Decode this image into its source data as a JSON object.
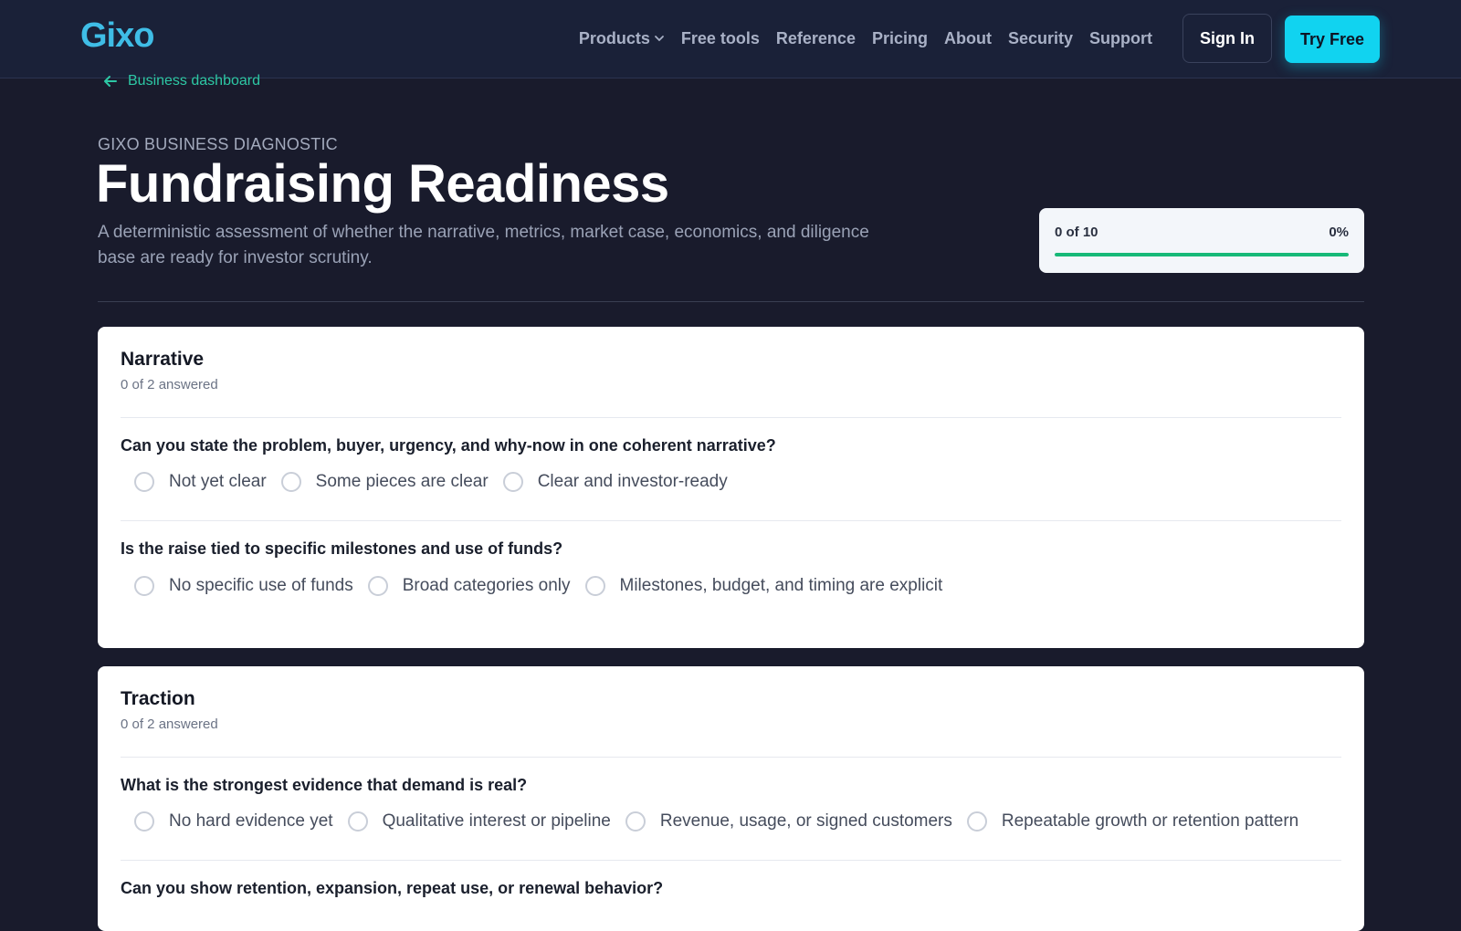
{
  "header": {
    "logo": "Gixo",
    "nav": [
      {
        "label": "Products",
        "has_dropdown": true
      },
      {
        "label": "Free tools"
      },
      {
        "label": "Reference"
      },
      {
        "label": "Pricing"
      },
      {
        "label": "About"
      },
      {
        "label": "Security"
      },
      {
        "label": "Support"
      }
    ],
    "sign_in": "Sign In",
    "try_free": "Try Free"
  },
  "page": {
    "back_link": "Business dashboard",
    "eyebrow": "GIXO BUSINESS DIAGNOSTIC",
    "title": "Fundraising Readiness",
    "subtitle": "A deterministic assessment of whether the narrative, metrics, market case, economics, and diligence base are ready for investor scrutiny.",
    "progress": {
      "count_label": "0 of 10",
      "percent_label": "0%"
    }
  },
  "sections": [
    {
      "title": "Narrative",
      "answered": "0 of 2 answered",
      "questions": [
        {
          "text": "Can you state the problem, buyer, urgency, and why-now in one coherent narrative?",
          "options": [
            "Not yet clear",
            "Some pieces are clear",
            "Clear and investor-ready"
          ]
        },
        {
          "text": "Is the raise tied to specific milestones and use of funds?",
          "options": [
            "No specific use of funds",
            "Broad categories only",
            "Milestones, budget, and timing are explicit"
          ]
        }
      ]
    },
    {
      "title": "Traction",
      "answered": "0 of 2 answered",
      "questions": [
        {
          "text": "What is the strongest evidence that demand is real?",
          "options": [
            "No hard evidence yet",
            "Qualitative interest or pipeline",
            "Revenue, usage, or signed customers",
            "Repeatable growth or retention pattern"
          ]
        },
        {
          "text": "Can you show retention, expansion, repeat use, or renewal behavior?",
          "options": []
        }
      ]
    }
  ],
  "colors": {
    "background": "#191b2c",
    "header": "#1a2138",
    "logo": "#3fbde6",
    "accent_cta": "#11d3f0",
    "link": "#2dc8a5",
    "progress_fill": "#17b978"
  },
  "icons": {
    "back": "arrow-left-icon",
    "dropdown": "chevron-down-icon"
  }
}
